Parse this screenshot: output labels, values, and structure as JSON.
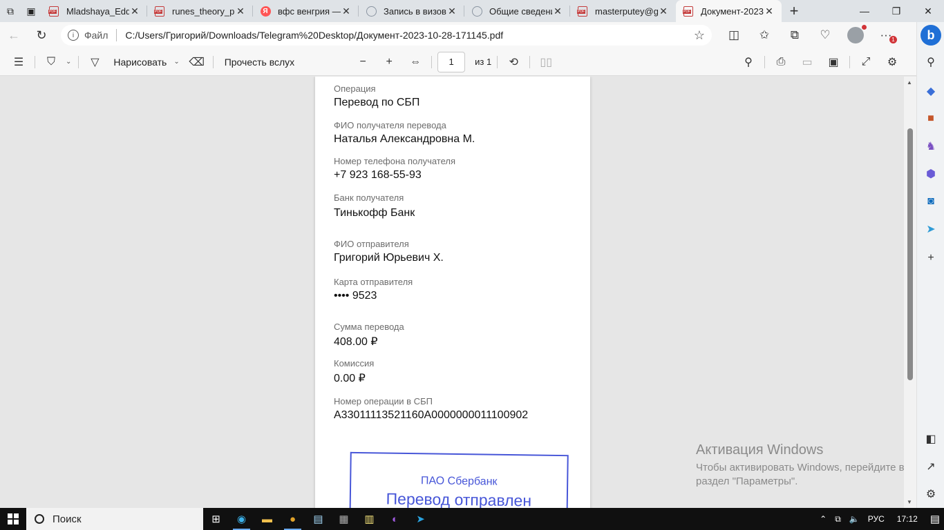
{
  "tabs": [
    {
      "title": "Mladshaya_Edda",
      "favicon": "pdf-icon",
      "active": false
    },
    {
      "title": "runes_theory_pr",
      "favicon": "pdf-icon",
      "active": false
    },
    {
      "title": "вфс венгрия —",
      "favicon": "yandex-icon",
      "active": false
    },
    {
      "title": "Запись в визов",
      "favicon": "gov-icon",
      "active": false
    },
    {
      "title": "Общие сведени",
      "favicon": "gov-icon",
      "active": false
    },
    {
      "title": "masterputey@g",
      "favicon": "pdf-icon",
      "active": false
    },
    {
      "title": "Документ-2023",
      "favicon": "pdf-icon",
      "active": true
    }
  ],
  "address": {
    "protocol_label": "Файл",
    "url": "C:/Users/Григорий/Downloads/Telegram%20Desktop/Документ-2023-10-28-171145.pdf"
  },
  "pdf_toolbar": {
    "draw_label": "Нарисовать",
    "read_aloud_label": "Прочесть вслух",
    "current_page": "1",
    "page_total_label": "из 1"
  },
  "receipt": {
    "operation_label": "Операция",
    "operation_value": "Перевод по СБП",
    "recipient_name_label": "ФИО получателя перевода",
    "recipient_name_value": "Наталья Александровна М.",
    "recipient_phone_label": "Номер телефона получателя",
    "recipient_phone_value": "+7 923 168-55-93",
    "recipient_bank_label": "Банк получателя",
    "recipient_bank_value": "Тинькофф Банк",
    "sender_name_label": "ФИО отправителя",
    "sender_name_value": "Григорий Юрьевич Х.",
    "sender_card_label": "Карта отправителя",
    "sender_card_value": "•••• 9523",
    "amount_label": "Сумма перевода",
    "amount_value": "408.00  ₽",
    "fee_label": "Комиссия",
    "fee_value": "0.00  ₽",
    "sbp_op_label": "Номер операции в СБП",
    "sbp_op_value": "A33011113521160A0000000011100902"
  },
  "stamp": {
    "bank": "ПАО Сбербанк",
    "status": "Перевод отправлен"
  },
  "watermark": {
    "title": "Активация Windows",
    "line1": "Чтобы активировать Windows, перейдите в",
    "line2": "раздел \"Параметры\"."
  },
  "taskbar": {
    "search_label": "Поиск",
    "language": "РУС",
    "time": "17:12"
  },
  "colors": {
    "stamp_blue": "#4756d8",
    "accent_blue": "#1f6fd6"
  }
}
